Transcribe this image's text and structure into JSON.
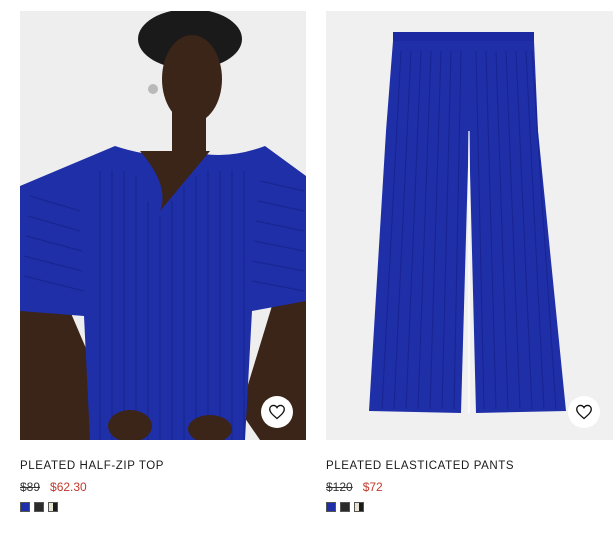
{
  "products": [
    {
      "title": "PLEATED HALF-ZIP TOP",
      "old_price": "$89",
      "new_price": "$62.30",
      "swatches": [
        "#1f2fa8",
        "#2b2b2b",
        "#e8e2d0"
      ]
    },
    {
      "title": "PLEATED ELASTICATED PANTS",
      "old_price": "$120",
      "new_price": "$72",
      "swatches": [
        "#1f2fa8",
        "#2b2b2b",
        "#e8e2d0"
      ]
    }
  ],
  "icons": {
    "wishlist": "heart-icon"
  },
  "colors": {
    "sale_price": "#c0392b",
    "garment_blue": "#1f2fa8"
  }
}
